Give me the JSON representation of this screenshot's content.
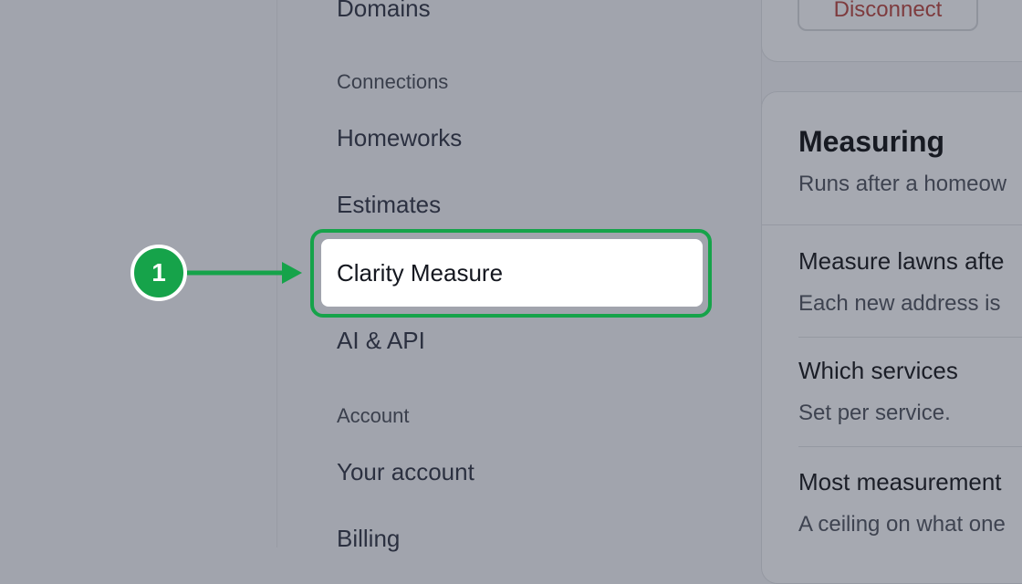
{
  "sidebar": {
    "items": [
      {
        "label": "Domains"
      },
      {
        "label": "Homeworks"
      },
      {
        "label": "Estimates"
      },
      {
        "label": "Clarity Measure"
      },
      {
        "label": "AI & API"
      },
      {
        "label": "Your account"
      },
      {
        "label": "Billing"
      }
    ],
    "sections": [
      {
        "label": "Connections"
      },
      {
        "label": "Account"
      }
    ],
    "active_item": "Clarity Measure"
  },
  "callout": {
    "number": "1",
    "color": "#16a34a"
  },
  "main": {
    "top_card": {
      "button_label": "Disconnect"
    },
    "card": {
      "title": "Measuring",
      "subtitle": "Runs after a homeow",
      "settings": [
        {
          "title": "Measure lawns afte",
          "desc": "Each new address is"
        },
        {
          "title": "Which services",
          "desc": "Set per service."
        },
        {
          "title": "Most measurement",
          "desc": "A ceiling on what one"
        }
      ]
    }
  }
}
